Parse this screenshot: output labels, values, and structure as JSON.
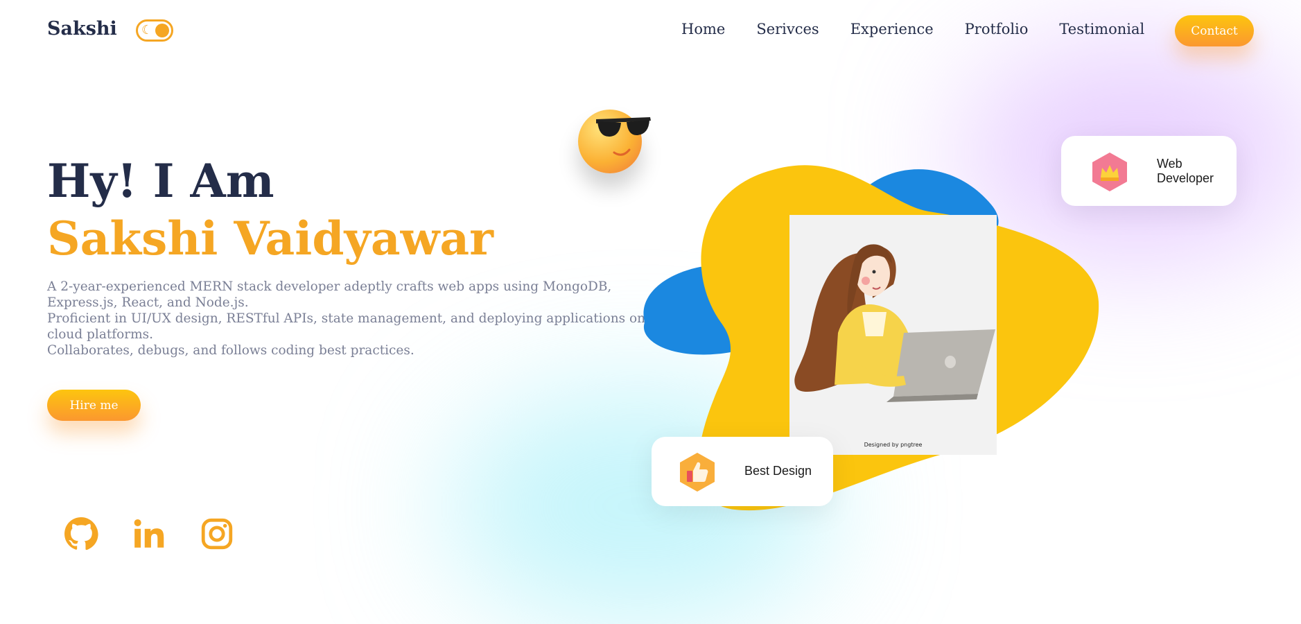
{
  "header": {
    "logo": "Sakshi",
    "theme_toggle_icon": "moon-icon",
    "nav": [
      "Home",
      "Serivces",
      "Experience",
      "Protfolio",
      "Testimonial"
    ],
    "contact_label": "Contact"
  },
  "hero": {
    "greeting": "Hy! I Am",
    "name": "Sakshi Vaidyawar",
    "description": [
      "A 2-year-experienced MERN stack developer adeptly crafts web apps using MongoDB, Express.js, React, and Node.js.",
      "Proficient in UI/UX design, RESTful APIs, state management, and deploying applications on cloud platforms.",
      "Collaborates, debugs, and follows coding best practices."
    ],
    "hire_label": "Hire me"
  },
  "socials": [
    "github-icon",
    "linkedin-icon",
    "instagram-icon"
  ],
  "floating_cards": {
    "web": {
      "line1": "Web",
      "line2": "Developer",
      "icon": "crown-icon"
    },
    "best": {
      "label": "Best Design",
      "icon": "thumbs-up-icon"
    }
  },
  "illustration": {
    "watermark": "Designed by pngtree"
  },
  "colors": {
    "accent": "#f5a623",
    "navy": "#242d49",
    "blob_yellow": "#fbc50e",
    "blob_blue": "#1b88e0"
  }
}
